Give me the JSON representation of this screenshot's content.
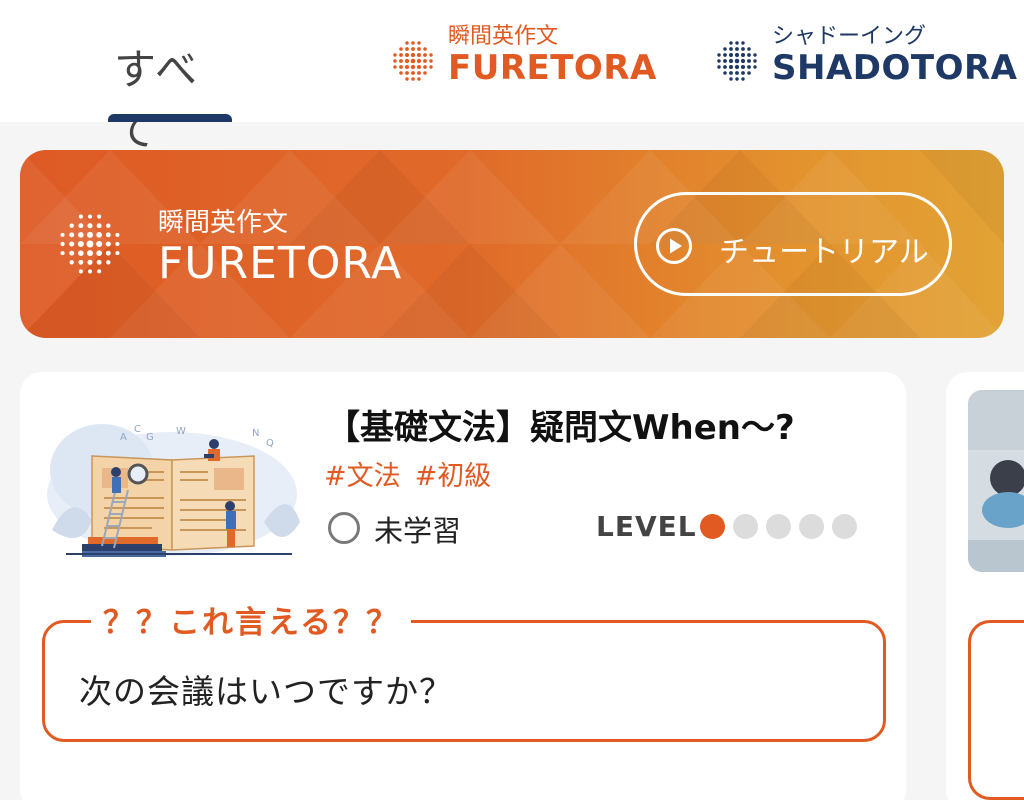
{
  "tabs": {
    "all_label": "すべて",
    "fure": {
      "sub": "瞬間英作文",
      "main": "FURETORA"
    },
    "shado": {
      "sub": "シャドーイング",
      "main": "SHADOTORA"
    }
  },
  "banner": {
    "subtitle": "瞬間英作文",
    "title": "FURETORA",
    "tutorial_label": "チュートリアル"
  },
  "lesson": {
    "title": "【基礎文法】疑問文When～?",
    "tags": [
      "#文法",
      "#初級"
    ],
    "status": "未学習",
    "level_label": "LEVEL",
    "level": 1,
    "level_max": 5,
    "quiz_legend": "？？これ言える？？",
    "quiz_question": "次の会議はいつですか？"
  },
  "colors": {
    "fure_orange": "#e05a22",
    "shado_navy": "#1e3966",
    "level_off": "#dcdcdc"
  },
  "icons": [
    "dot-grid-icon",
    "play-icon",
    "lesson-illustration"
  ]
}
